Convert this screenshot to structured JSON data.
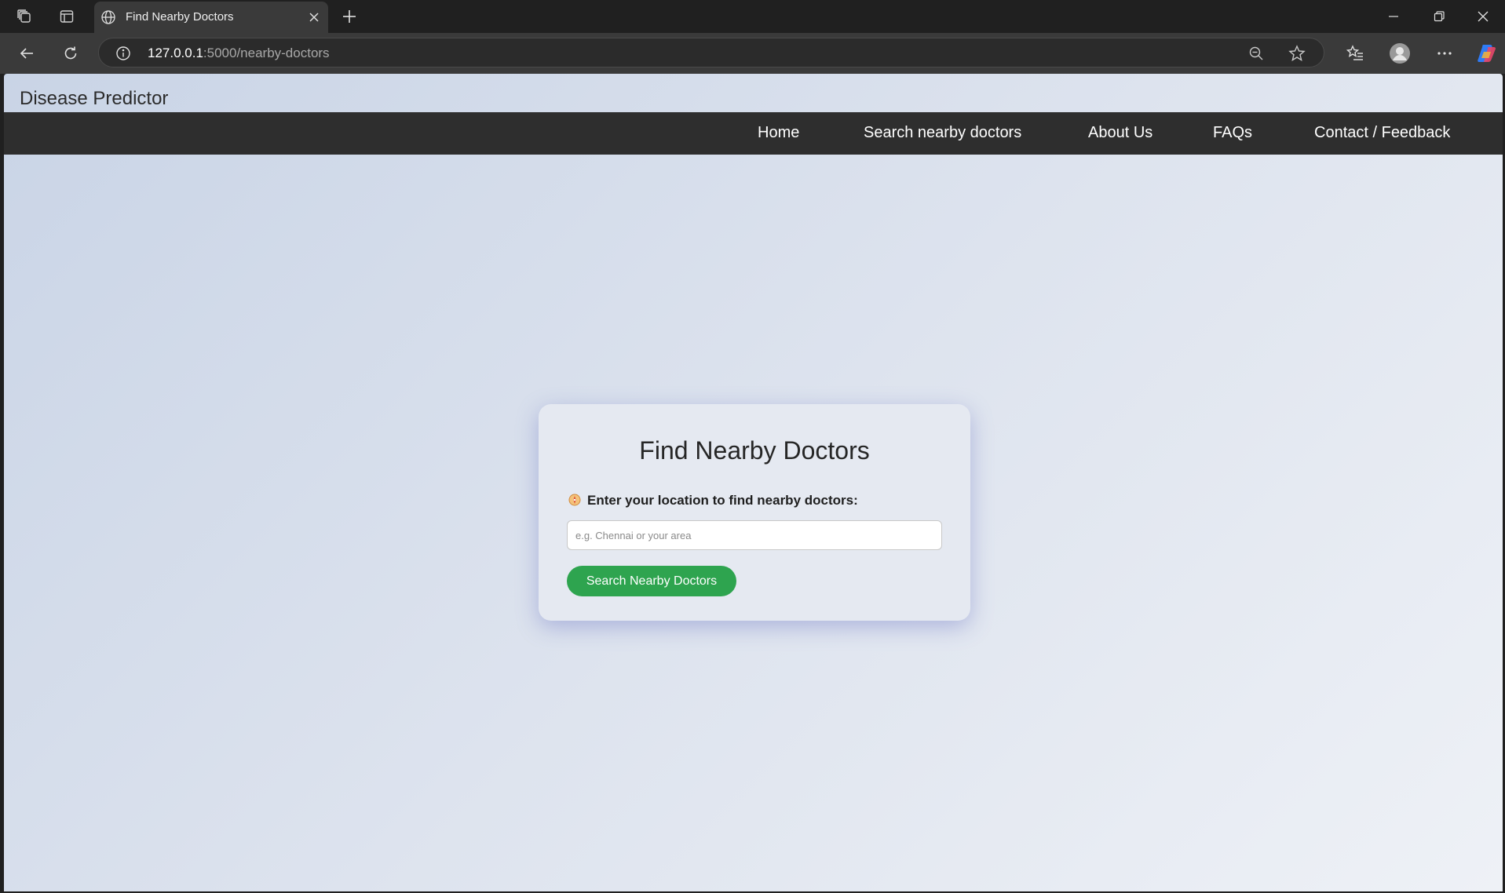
{
  "browser": {
    "tab": {
      "title": "Find Nearby Doctors"
    },
    "address": {
      "host": "127.0.0.1",
      "path": ":5000/nearby-doctors"
    },
    "icons": {
      "workspaces": "workspaces-icon",
      "tab_actions": "tab-actions-icon",
      "globe": "globe-icon",
      "close_tab": "close-icon",
      "new_tab": "plus-icon",
      "minimize": "minimize-icon",
      "restore": "restore-icon",
      "close_window": "close-icon",
      "back": "back-arrow-icon",
      "reload": "reload-icon",
      "site_info": "info-icon",
      "zoom": "zoom-out-icon",
      "favorite": "star-icon",
      "favorites": "favorites-icon",
      "profile": "profile-icon",
      "more": "more-icon",
      "copilot": "copilot-icon"
    }
  },
  "site": {
    "title": "Disease Predictor",
    "nav": [
      "Home",
      "Search nearby doctors",
      "About Us",
      "FAQs",
      "Contact / Feedback"
    ]
  },
  "card": {
    "title": "Find Nearby Doctors",
    "label": "Enter your location to find nearby doctors:",
    "label_icon": "compass-icon",
    "input_value": "",
    "input_placeholder": "e.g. Chennai or your area",
    "button": "Search Nearby Doctors"
  },
  "colors": {
    "nav_bg": "#2e2e2e",
    "button_green": "#2ea44f",
    "card_bg": "#e5e9f1",
    "page_gradient_start": "#c9d4e6",
    "page_gradient_end": "#eef1f6"
  }
}
